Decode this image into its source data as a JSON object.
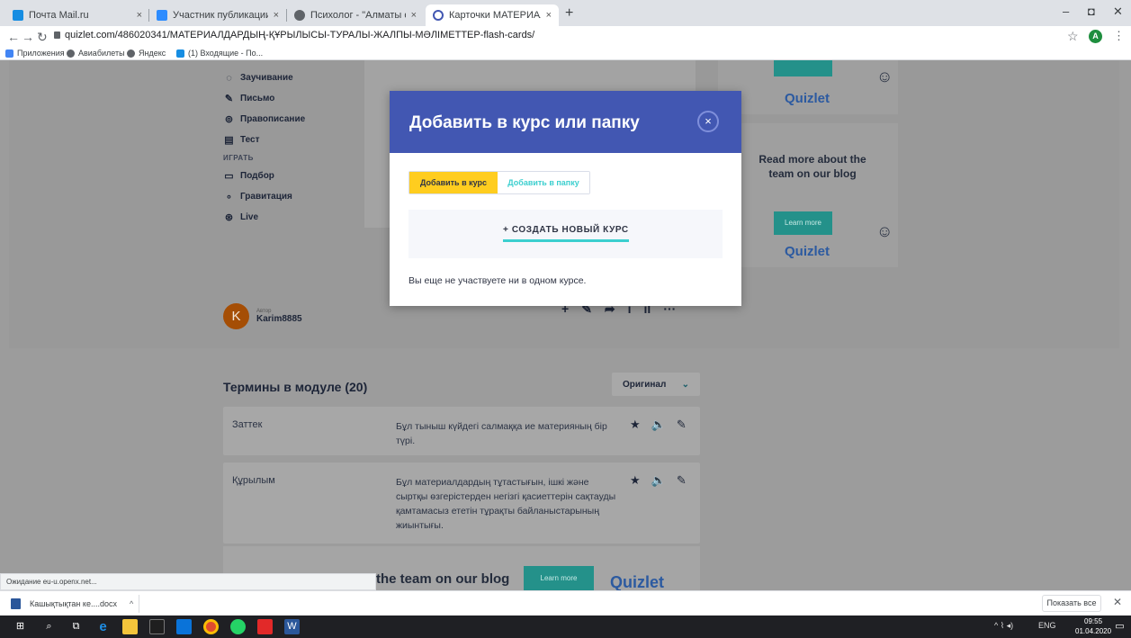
{
  "browser": {
    "tabs": [
      {
        "title": "Почта Mail.ru",
        "icon": "mail-icon"
      },
      {
        "title": "Участник публикации - Zoom",
        "icon": "zoom-icon"
      },
      {
        "title": "Психолог - \"Алматы облысты",
        "icon": "globe-icon"
      },
      {
        "title": "Карточки МАТЕРИАЛДАРДЫН",
        "icon": "quizlet-icon"
      }
    ],
    "tab_close": "×",
    "new_tab": "+",
    "window_controls": {
      "minimize": "–",
      "maximize": "◘",
      "close": "✕"
    },
    "url": "quizlet.com/486020341/МАТЕРИАЛДАРДЫҢ-ҚҰРЫЛЫСЫ-ТУРАЛЫ-ЖАЛПЫ-МӘЛІМЕТТЕР-flash-cards/",
    "profile_initial": "A",
    "bookmarks": [
      "Приложения",
      "Авиабилеты",
      "Яндекс",
      "(1) Входящие - По..."
    ]
  },
  "left_menu": {
    "study_items": [
      {
        "label": "Заучивание",
        "icon": "learn-icon"
      },
      {
        "label": "Письмо",
        "icon": "write-icon"
      },
      {
        "label": "Правописание",
        "icon": "spell-icon"
      },
      {
        "label": "Тест",
        "icon": "test-icon"
      }
    ],
    "play_heading": "ИГРАТЬ",
    "play_items": [
      {
        "label": "Подбор",
        "icon": "match-icon"
      },
      {
        "label": "Гравитация",
        "icon": "gravity-icon"
      },
      {
        "label": "Live",
        "icon": "live-icon"
      }
    ]
  },
  "ads": {
    "brand": "Quizlet",
    "blog_text": "Read more about the team on our blog",
    "learn_more": "Learn more",
    "bottom_text": "the team on our blog"
  },
  "author": {
    "label": "Автор",
    "name": "Karim8885",
    "initial": "K"
  },
  "terms": {
    "title": "Термины в модуле (20)",
    "sort_label": "Оригинал",
    "items": [
      {
        "term": "Заттек",
        "definition": "Бұл тыныш күйдегі салмаққа ие материяның бір түрі."
      },
      {
        "term": "Құрылым",
        "definition": "Бұл материалдардың тұтастығын, ішкі және сыртқы өзгерістерден негізгі қасиеттерін сақтауды қамтамасыз ететін тұрақты байланыстарының жиынтығы."
      }
    ]
  },
  "modal": {
    "title": "Добавить в курс или папку",
    "close": "×",
    "tab_course": "Добавить в курс",
    "tab_folder": "Добавить в папку",
    "create_course": "+ СОЗДАТЬ НОВЫЙ КУРС",
    "empty_note": "Вы еще не участвуете ни в одном курсе.",
    "colors": {
      "header": "#4257b2",
      "active_tab": "#ffcd1f",
      "accent": "#3ccfcf"
    }
  },
  "status": "Ожидание eu-u.openx.net...",
  "downloads": {
    "file": "Кашықтықтан ке....docx",
    "show_all": "Показать все",
    "close": "✕"
  },
  "taskbar": {
    "lang": "ENG",
    "time": "09:55",
    "date": "01.04.2020"
  }
}
